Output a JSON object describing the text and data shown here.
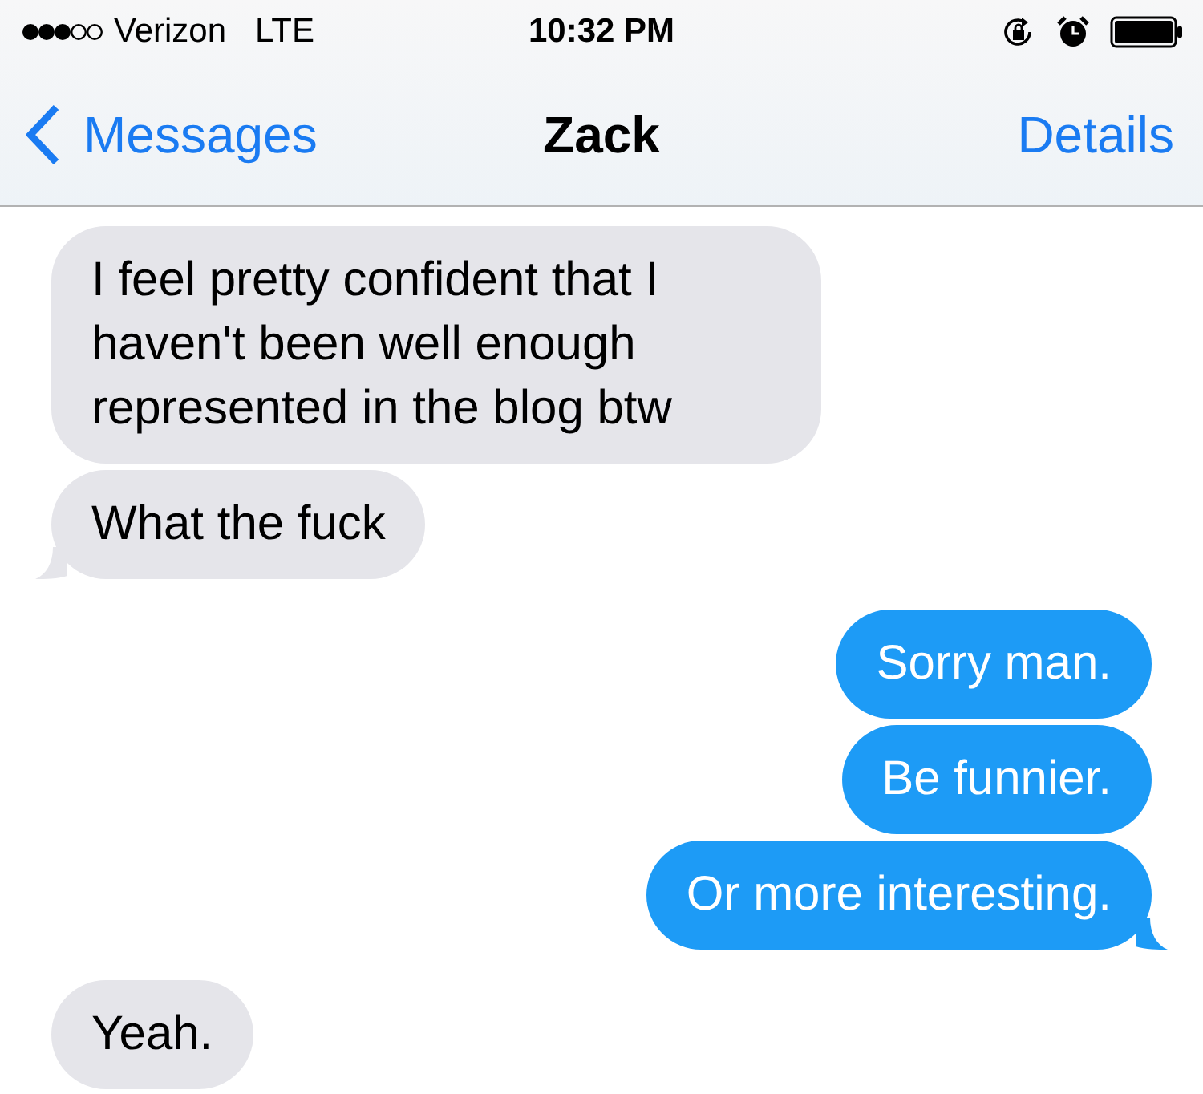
{
  "status_bar": {
    "carrier": "Verizon",
    "network": "LTE",
    "time": "10:32 PM"
  },
  "nav": {
    "back": "Messages",
    "title": "Zack",
    "action": "Details"
  },
  "messages": [
    {
      "kind": "received",
      "text": "I feel pretty confident that I haven't been well enough represented in the blog btw",
      "tail": false
    },
    {
      "kind": "received",
      "text": "What the fuck",
      "tail": true
    },
    {
      "kind": "sent",
      "text": "Sorry man.",
      "tail": false
    },
    {
      "kind": "sent",
      "text": "Be funnier.",
      "tail": false
    },
    {
      "kind": "sent",
      "text": "Or more interesting.",
      "tail": true
    },
    {
      "kind": "received",
      "text": "Yeah.",
      "tail": false
    }
  ]
}
